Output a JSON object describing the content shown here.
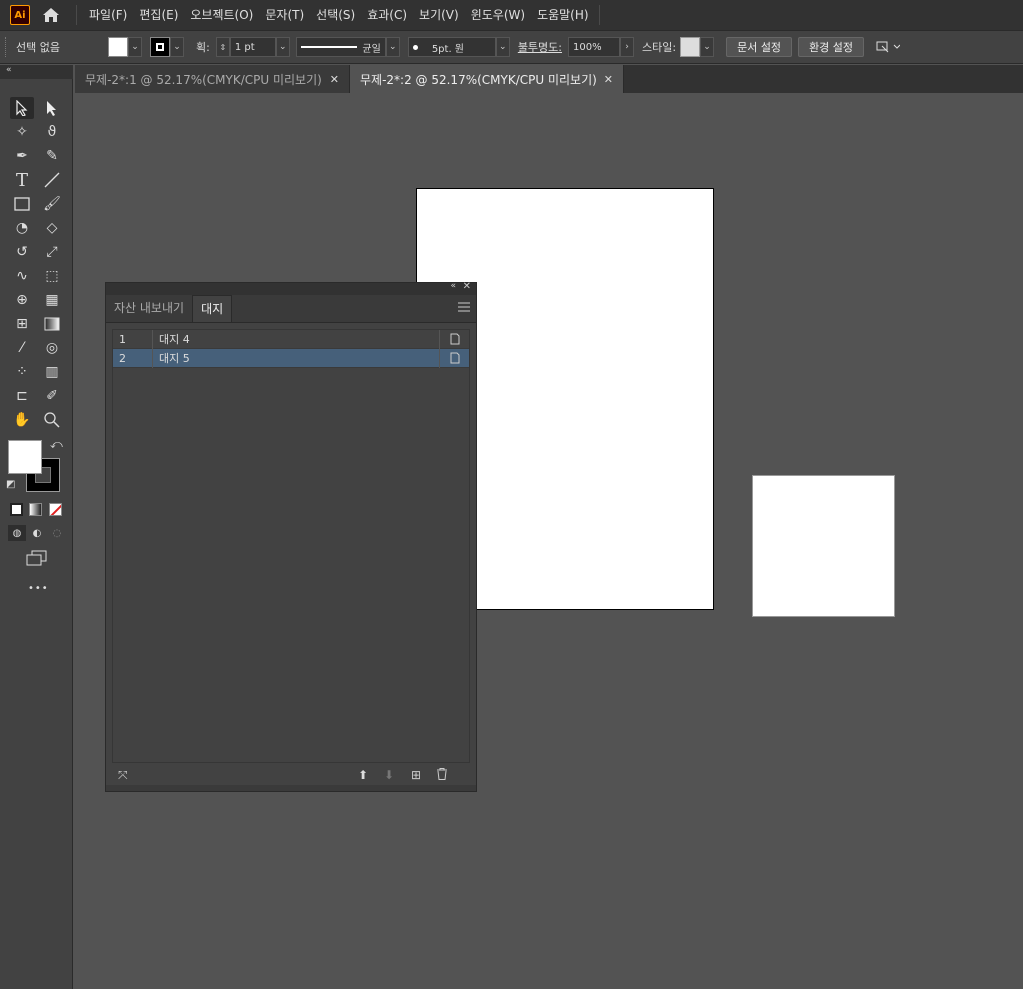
{
  "app": {
    "logo_text": "Ai",
    "menu": [
      "파일(F)",
      "편집(E)",
      "오브젝트(O)",
      "문자(T)",
      "선택(S)",
      "효과(C)",
      "보기(V)",
      "윈도우(W)",
      "도움말(H)"
    ]
  },
  "control_bar": {
    "selection_label": "선택 없음",
    "stroke_label": "획:",
    "stroke_weight": "1 pt",
    "stroke_profile": "균일",
    "brush_label": "5pt. 원",
    "opacity_label": "불투명도:",
    "opacity_value": "100%",
    "style_label": "스타일:",
    "doc_setup_button": "문서 설정",
    "preferences_button": "환경 설정"
  },
  "tabs": [
    {
      "label": "무제-2*:1 @ 52.17%(CMYK/CPU 미리보기)",
      "active": false
    },
    {
      "label": "무제-2*:2 @ 52.17%(CMYK/CPU 미리보기)",
      "active": true
    }
  ],
  "panel": {
    "tabs": [
      "자산 내보내기",
      "대지"
    ],
    "artboards": [
      {
        "num": "1",
        "name": "대지 4",
        "selected": false
      },
      {
        "num": "2",
        "name": "대지 5",
        "selected": true
      }
    ]
  },
  "colors": {
    "accent": "#ff9a00",
    "selected_row": "#46607a",
    "canvas": "#535353"
  },
  "toolbar": {
    "more_label": "•••"
  }
}
